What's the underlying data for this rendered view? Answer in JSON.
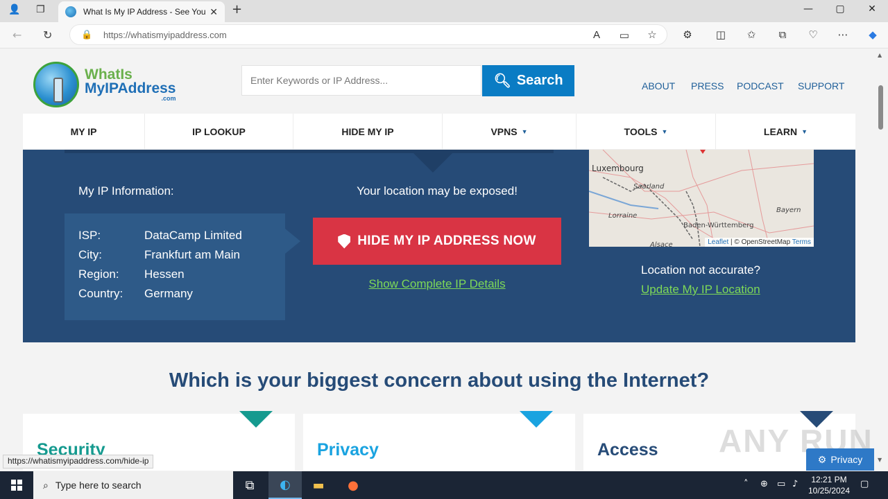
{
  "browser": {
    "tab_title": "What Is My IP Address - See Your",
    "tab_close": "✕",
    "new_tab": "+",
    "url_host": "https://whatismyipaddress.com",
    "status_url": "https://whatismyipaddress.com/hide-ip",
    "window": {
      "minimize": "—",
      "maximize": "▢",
      "close": "✕"
    }
  },
  "site": {
    "logo": {
      "line1": "WhatIs",
      "line2": "MyIPAddress",
      "line3": ".com"
    },
    "search": {
      "placeholder": "Enter Keywords or IP Address...",
      "button": "Search"
    },
    "toplinks": [
      "ABOUT",
      "PRESS",
      "PODCAST",
      "SUPPORT"
    ],
    "nav": [
      {
        "label": "MY IP",
        "caret": ""
      },
      {
        "label": "IP LOOKUP",
        "caret": ""
      },
      {
        "label": "HIDE MY IP",
        "caret": ""
      },
      {
        "label": "VPNS",
        "caret": "▼"
      },
      {
        "label": "TOOLS",
        "caret": "▼"
      },
      {
        "label": "LEARN",
        "caret": "▼"
      }
    ]
  },
  "hero": {
    "info_heading": "My IP Information:",
    "info": [
      {
        "key": "ISP:",
        "value": "DataCamp Limited"
      },
      {
        "key": "City:",
        "value": "Frankfurt am Main"
      },
      {
        "key": "Region:",
        "value": "Hessen"
      },
      {
        "key": "Country:",
        "value": "Germany"
      }
    ],
    "exposed": "Your location may be exposed!",
    "hide_button": "HIDE MY IP ADDRESS NOW",
    "details_link": "Show Complete IP Details",
    "map": {
      "labels": [
        "Luxembourg",
        "Saarland",
        "Lorraine",
        "Bayern",
        "Baden-Württemberg",
        "Alsace"
      ],
      "attribution_leaflet": "Leaflet",
      "attribution_sep": " | © OpenStreetMap ",
      "attribution_terms": "Terms"
    },
    "location_q": "Location not accurate?",
    "location_link": "Update My IP Location"
  },
  "concern": {
    "heading": "Which is your biggest concern about using the Internet?",
    "cards": [
      {
        "title": "Security",
        "color": "#159a8f"
      },
      {
        "title": "Privacy",
        "color": "#1aa3e0"
      },
      {
        "title": "Access",
        "color": "#264b77"
      }
    ]
  },
  "privacy_pill": "Privacy",
  "watermark": "ANY RUN",
  "taskbar": {
    "search_placeholder": "Type here to search",
    "time": "12:21 PM",
    "date": "10/25/2024"
  }
}
